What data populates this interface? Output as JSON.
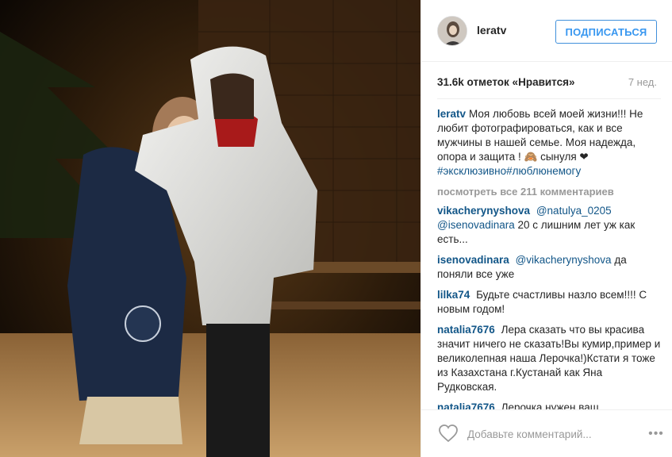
{
  "post": {
    "photo_alt": "",
    "header": {
      "username": "leratv",
      "follow_label": "ПОДПИСАТЬСЯ"
    },
    "likes": "31.6k отметок «Нравится»",
    "time_ago": "7 нед.",
    "caption": {
      "username": "leratv",
      "text_before_tags": "Моя любовь всей моей жизни!!! Не любит фотографироваться, как и все мужчины в нашей семье. Моя надежда, опора и защита ! 🙈 сынуля ❤",
      "hashtags": "#эксклюзивно#люблюнемогу"
    },
    "view_all": "посмотреть все 211 комментариев",
    "comments": [
      {
        "username": "vikacherynyshova",
        "mentions": "@natulya_0205 @isenovadinara",
        "text": "20 с лишним лет уж как есть..."
      },
      {
        "username": "isenovadinara",
        "mentions": "@vikacherynyshova",
        "text": "да поняли все уже"
      },
      {
        "username": "lilka74",
        "mentions": "",
        "text": "Будьте счастливы назло всем!!!! С новым годом!"
      },
      {
        "username": "natalia7676",
        "mentions": "",
        "text": "Лера сказать что вы красива значит ничего не сказать!Вы кумир,пример и великолепная наша Лерочка!)Кстати я тоже из Казахстана г.Кустанай как Яна Рудковская."
      },
      {
        "username": "natalia7676",
        "mentions": "",
        "text": "Лерочка нужен ваш совет.Моего брата везде сократили из"
      }
    ],
    "footer": {
      "comment_placeholder": "Добавьте комментарий...",
      "more_label": "•••",
      "like_icon": "heart-outline-icon",
      "more_icon": "ellipsis-icon"
    },
    "colors": {
      "link": "#125688",
      "follow": "#3897f0",
      "muted": "#999999",
      "text": "#262626"
    }
  }
}
